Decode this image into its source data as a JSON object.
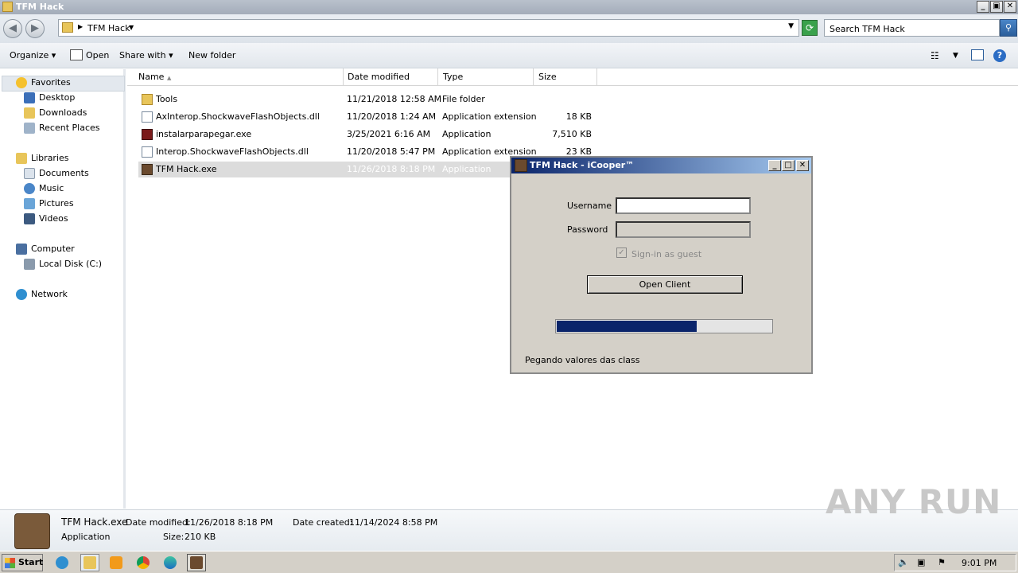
{
  "window": {
    "title": "TFM Hack",
    "min_label": "_",
    "max_label": "▣",
    "close_label": "✕"
  },
  "address": {
    "breadcrumb": "TFM Hack",
    "search_placeholder": "Search TFM Hack"
  },
  "toolbar": {
    "organize": "Organize",
    "open": "Open",
    "share_with": "Share with",
    "new_folder": "New folder"
  },
  "sidebar": {
    "favorites": "Favorites",
    "desktop": "Desktop",
    "downloads": "Downloads",
    "recent_places": "Recent Places",
    "libraries": "Libraries",
    "documents": "Documents",
    "music": "Music",
    "pictures": "Pictures",
    "videos": "Videos",
    "computer": "Computer",
    "local_disk": "Local Disk (C:)",
    "network": "Network"
  },
  "columns": {
    "name": "Name",
    "date_modified": "Date modified",
    "type": "Type",
    "size": "Size"
  },
  "files": [
    {
      "name": "Tools",
      "date": "11/21/2018 12:58 AM",
      "type": "File folder",
      "size": "",
      "icon": "folder-icon"
    },
    {
      "name": "AxInterop.ShockwaveFlashObjects.dll",
      "date": "11/20/2018 1:24 AM",
      "type": "Application extension",
      "size": "18 KB",
      "icon": "dll-icon"
    },
    {
      "name": "instalarparapegar.exe",
      "date": "3/25/2021 6:16 AM",
      "type": "Application",
      "size": "7,510 KB",
      "icon": "exe-icon"
    },
    {
      "name": "Interop.ShockwaveFlashObjects.dll",
      "date": "11/20/2018 5:47 PM",
      "type": "Application extension",
      "size": "23 KB",
      "icon": "dll-icon"
    },
    {
      "name": "TFM Hack.exe",
      "date": "11/26/2018 8:18 PM",
      "type": "Application",
      "size": "",
      "icon": "app-icon"
    }
  ],
  "details": {
    "filename": "TFM Hack.exe",
    "type": "Application",
    "date_modified_label": "Date modified:",
    "date_modified": "11/26/2018 8:18 PM",
    "date_created_label": "Date created:",
    "date_created": "11/14/2024 8:58 PM",
    "size_label": "Size:",
    "size": "210 KB"
  },
  "dialog": {
    "title": "TFM Hack - iCooper™",
    "username_label": "Username",
    "password_label": "Password",
    "guest_label": "Sign-in as guest",
    "guest_checked": true,
    "open_client": "Open Client",
    "progress": 0.65,
    "status": "Pegando valores das class"
  },
  "taskbar": {
    "start": "Start",
    "clock": "9:01 PM"
  },
  "watermark": "ANY RUN"
}
